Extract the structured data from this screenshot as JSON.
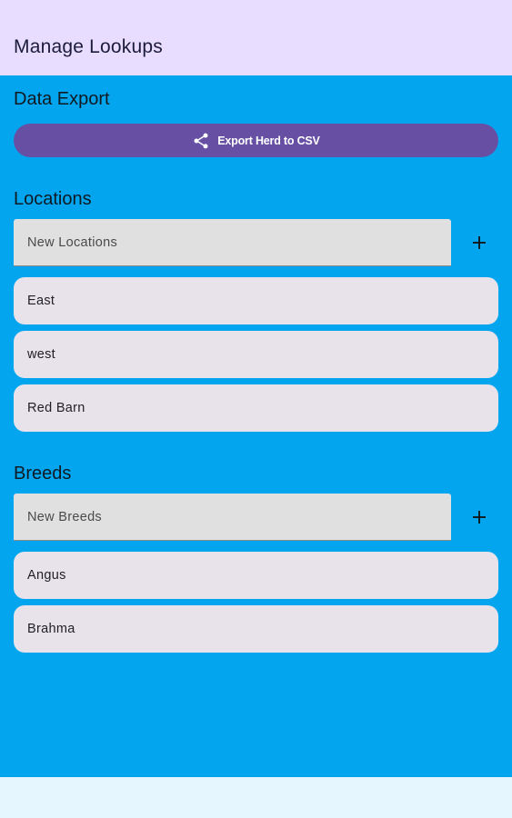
{
  "app_bar": {
    "title": "Manage Lookups"
  },
  "export": {
    "heading": "Data Export",
    "button_label": "Export Herd to CSV",
    "icon": "share-icon"
  },
  "locations": {
    "heading": "Locations",
    "input_placeholder": "New Locations",
    "add_icon": "plus-icon",
    "items": [
      {
        "label": "East"
      },
      {
        "label": "west"
      },
      {
        "label": "Red Barn"
      }
    ]
  },
  "breeds": {
    "heading": "Breeds",
    "input_placeholder": "New Breeds",
    "add_icon": "plus-icon",
    "items": [
      {
        "label": "Angus"
      },
      {
        "label": "Brahma"
      }
    ]
  },
  "colors": {
    "app_bar": "#e8ddff",
    "content_background": "#03a5ef",
    "button": "#6750a4",
    "card": "#e8e3ea",
    "input": "#e0e0e0"
  }
}
